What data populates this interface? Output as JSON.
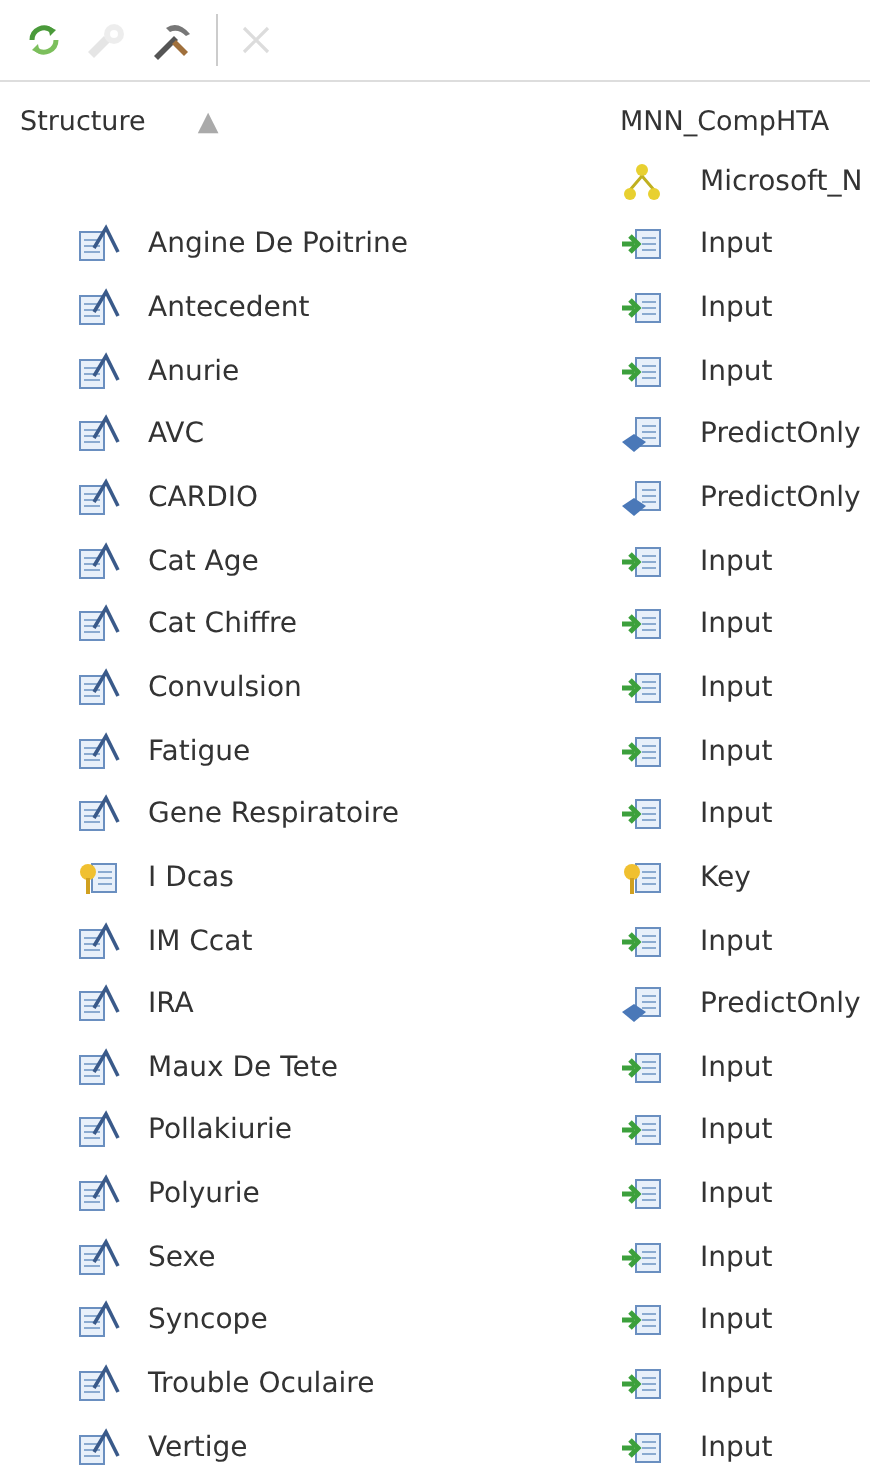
{
  "toolbar": [
    {
      "kind": "refresh",
      "disabled": false
    },
    {
      "kind": "process",
      "disabled": true
    },
    {
      "kind": "tools",
      "disabled": false
    },
    {
      "kind": "separator"
    },
    {
      "kind": "delete",
      "disabled": true
    }
  ],
  "columns": [
    {
      "label": "Structure",
      "sort": "▲"
    },
    {
      "label": "MNN_CompHTA"
    }
  ],
  "model_row": {
    "kind": "model",
    "text": "Microsoft_N"
  },
  "rows": [
    {
      "kind": "attribute",
      "name": "Angine De Poitrine",
      "usage": {
        "kind": "input",
        "text": "Input"
      }
    },
    {
      "kind": "attribute",
      "name": "Antecedent",
      "usage": {
        "kind": "input",
        "text": "Input"
      }
    },
    {
      "kind": "attribute",
      "name": "Anurie",
      "usage": {
        "kind": "input",
        "text": "Input"
      }
    },
    {
      "kind": "attribute",
      "name": "AVC",
      "usage": {
        "kind": "predict",
        "text": "PredictOnly"
      }
    },
    {
      "kind": "attribute",
      "name": "CARDIO",
      "usage": {
        "kind": "predict",
        "text": "PredictOnly"
      }
    },
    {
      "kind": "attribute",
      "name": "Cat Age",
      "usage": {
        "kind": "input",
        "text": "Input"
      }
    },
    {
      "kind": "attribute",
      "name": "Cat Chiffre",
      "usage": {
        "kind": "input",
        "text": "Input"
      }
    },
    {
      "kind": "attribute",
      "name": "Convulsion",
      "usage": {
        "kind": "input",
        "text": "Input"
      }
    },
    {
      "kind": "attribute",
      "name": "Fatigue",
      "usage": {
        "kind": "input",
        "text": "Input"
      }
    },
    {
      "kind": "attribute",
      "name": "Gene Respiratoire",
      "usage": {
        "kind": "input",
        "text": "Input"
      }
    },
    {
      "kind": "key",
      "name": "I Dcas",
      "usage": {
        "kind": "key",
        "text": "Key"
      }
    },
    {
      "kind": "attribute",
      "name": "IM Ccat",
      "usage": {
        "kind": "input",
        "text": "Input"
      }
    },
    {
      "kind": "attribute",
      "name": "IRA",
      "usage": {
        "kind": "predict",
        "text": "PredictOnly"
      }
    },
    {
      "kind": "attribute",
      "name": "Maux De Tete",
      "usage": {
        "kind": "input",
        "text": "Input"
      }
    },
    {
      "kind": "attribute",
      "name": "Pollakiurie",
      "usage": {
        "kind": "input",
        "text": "Input"
      }
    },
    {
      "kind": "attribute",
      "name": "Polyurie",
      "usage": {
        "kind": "input",
        "text": "Input"
      }
    },
    {
      "kind": "attribute",
      "name": "Sexe",
      "usage": {
        "kind": "input",
        "text": "Input"
      }
    },
    {
      "kind": "attribute",
      "name": "Syncope",
      "usage": {
        "kind": "input",
        "text": "Input"
      }
    },
    {
      "kind": "attribute",
      "name": "Trouble Oculaire",
      "usage": {
        "kind": "input",
        "text": "Input"
      }
    },
    {
      "kind": "attribute",
      "name": "Vertige",
      "usage": {
        "kind": "input",
        "text": "Input"
      }
    }
  ]
}
